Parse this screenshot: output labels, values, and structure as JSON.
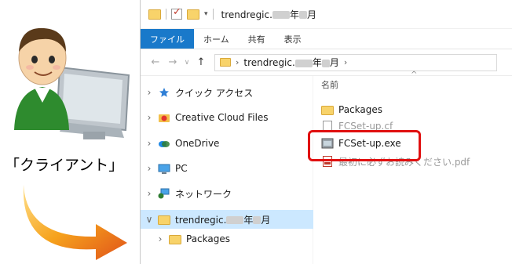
{
  "client_label": "「クライアント」",
  "titlebar": {
    "title_prefix": "trendregic.",
    "year_suffix": "年",
    "month_suffix": "月"
  },
  "ribbon": {
    "file": "ファイル",
    "home": "ホーム",
    "share": "共有",
    "view": "表示"
  },
  "address": {
    "back": "←",
    "forward": "→",
    "recent": "∨",
    "up": "↑",
    "sep": "›",
    "path_prefix": "trendregic.",
    "year_suffix": "年",
    "month_suffix": "月"
  },
  "nav_pane": {
    "chevron": "›",
    "expanded_chevron": "∨",
    "items": [
      {
        "label": "クイック アクセス",
        "icon": "star-icon"
      },
      {
        "label": "Creative Cloud Files",
        "icon": "creative-cloud-icon"
      },
      {
        "label": "OneDrive",
        "icon": "onedrive-icon"
      },
      {
        "label": "PC",
        "icon": "pc-icon"
      },
      {
        "label": "ネットワーク",
        "icon": "network-icon"
      }
    ],
    "selected": {
      "label_prefix": "trendregic.",
      "year_suffix": "年",
      "month_suffix": "月"
    },
    "child": {
      "label": "Packages"
    }
  },
  "file_list": {
    "column_name": "名前",
    "sort_caret": "^",
    "files": [
      {
        "name": "Packages",
        "icon": "folder-icon"
      },
      {
        "name": "FCSet-up.exe",
        "icon": "installer-icon"
      }
    ],
    "obscured_1": "FCSet-up.cf",
    "obscured_2": "最初に必ずお読みください.pdf"
  },
  "colors": {
    "ribbon_file_bg": "#1979ca",
    "selection_bg": "#cce8ff",
    "highlight": "#e01010",
    "folder": "#f8d36a"
  }
}
